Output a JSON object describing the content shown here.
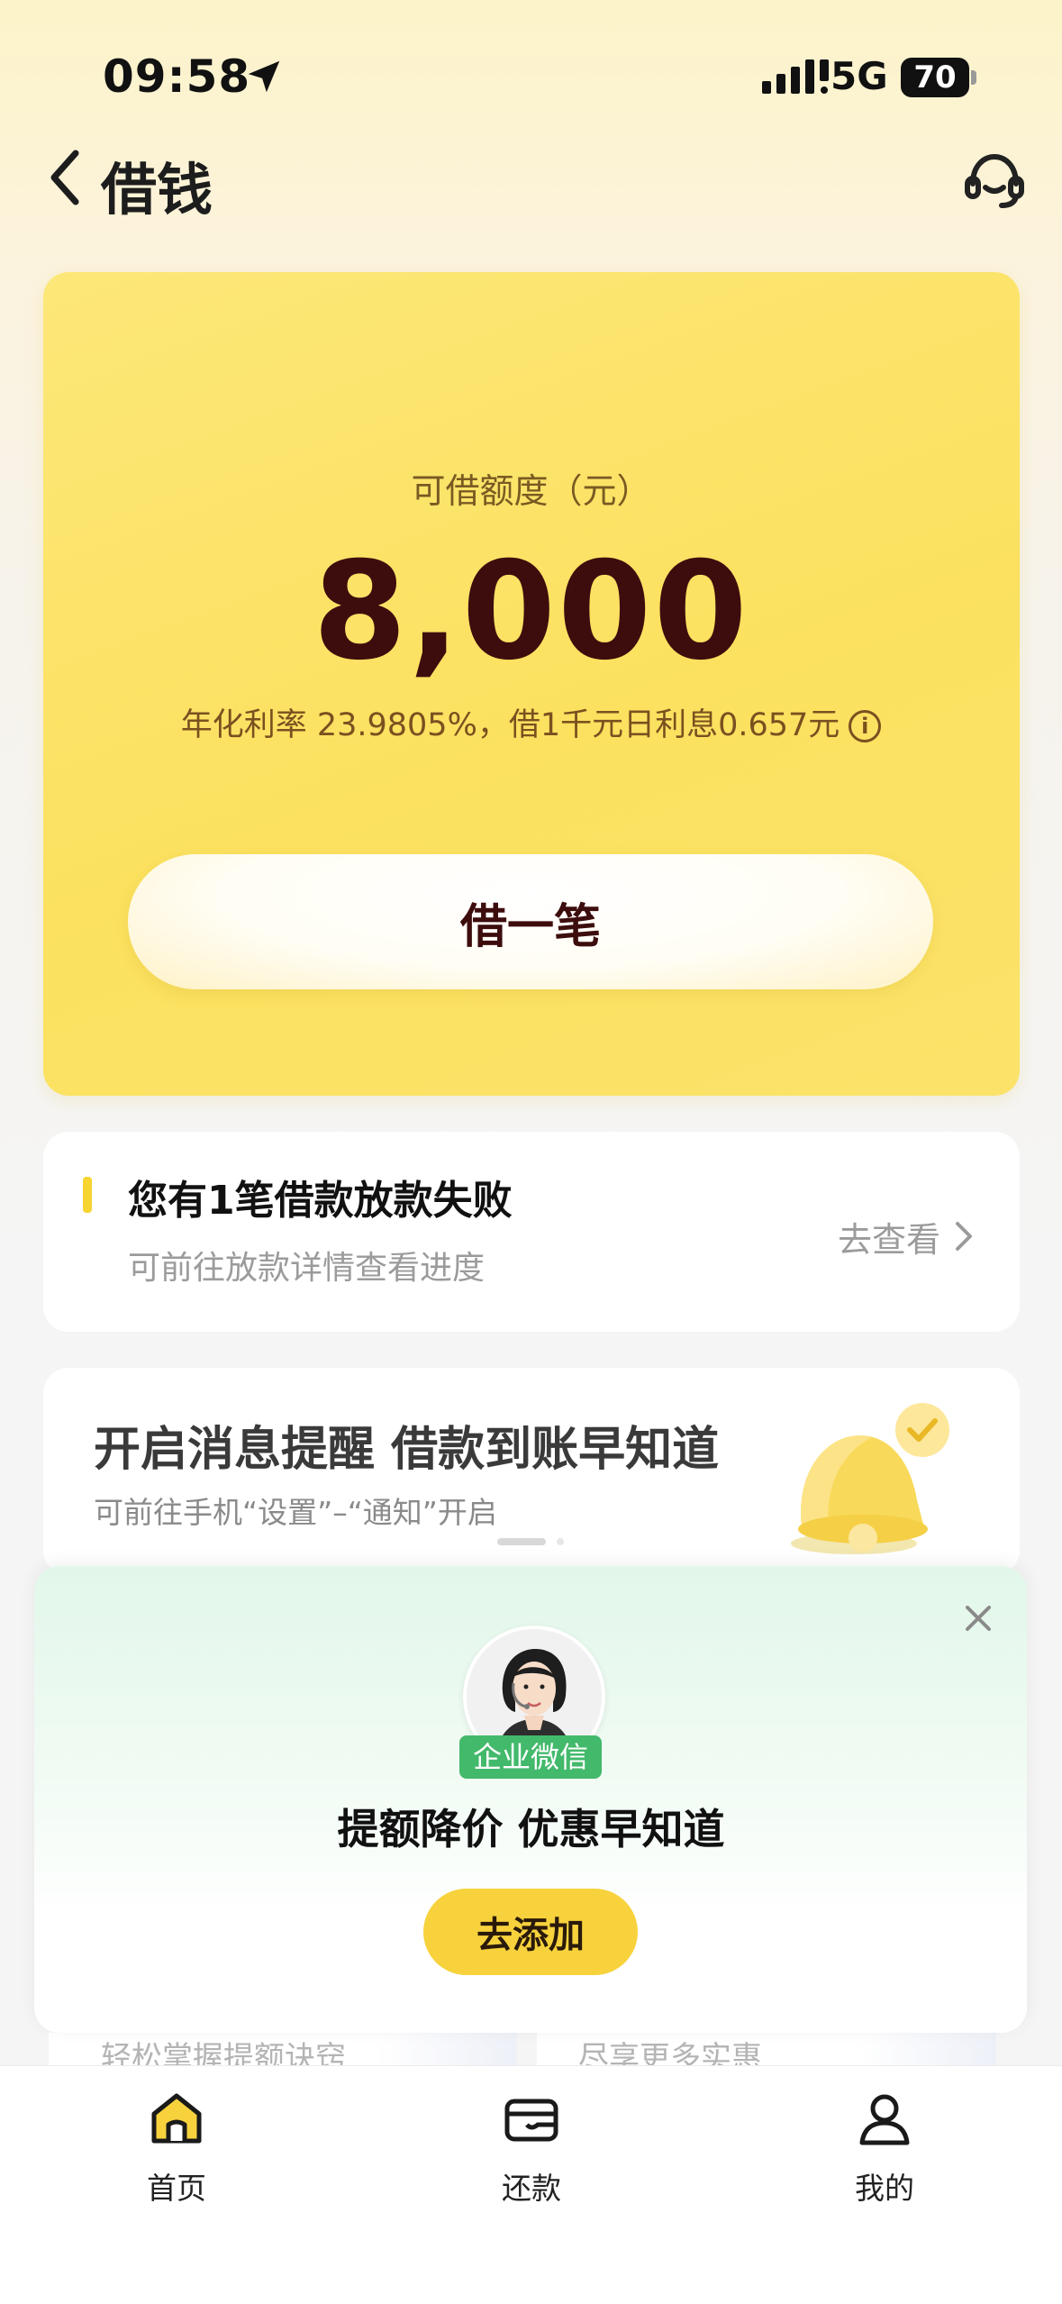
{
  "status_bar": {
    "time": "09:58",
    "network": "5G",
    "battery": "70"
  },
  "nav": {
    "title": "借钱",
    "back_icon": "chevron-left-icon",
    "service_icon": "customer-service-icon"
  },
  "credit": {
    "label": "可借额度（元）",
    "amount": "8,000",
    "rate_text": "年化利率 23.9805%，借1千元日利息0.657元",
    "borrow_button": "借一笔"
  },
  "notice": {
    "title": "您有1笔借款放款失败",
    "subtitle": "可前往放款详情查看进度",
    "link": "去查看"
  },
  "message_card": {
    "title": "开启消息提醒 借款到账早知道",
    "subtitle": "可前往手机“设置”–“通知”开启"
  },
  "popup": {
    "badge": "企业微信",
    "title": "提额降价 优惠早知道",
    "button": "去添加"
  },
  "peek_cards": {
    "left": "轻松掌握提额诀窍",
    "right": "尽享更多实惠"
  },
  "tabbar": {
    "items": [
      {
        "label": "首页",
        "icon": "home-icon",
        "active": true
      },
      {
        "label": "还款",
        "icon": "wallet-icon",
        "active": false
      },
      {
        "label": "我的",
        "icon": "user-icon",
        "active": false
      }
    ]
  },
  "colors": {
    "accent_yellow": "#f7d23c",
    "amount_text": "#3d0d0d",
    "wecom_green": "#43b96b"
  }
}
